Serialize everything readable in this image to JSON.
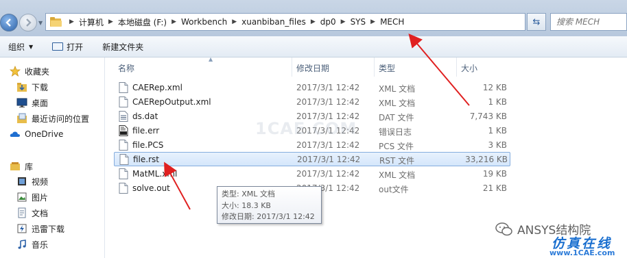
{
  "address_bar": {
    "breadcrumbs": [
      "计算机",
      "本地磁盘 (F:)",
      "Workbench",
      "xuanbiban_files",
      "dp0",
      "SYS",
      "MECH"
    ],
    "search_placeholder": "搜索 MECH"
  },
  "toolbar": {
    "organize_label": "组织",
    "open_label": "打开",
    "new_folder_label": "新建文件夹"
  },
  "sidebar": {
    "favorites_label": "收藏夹",
    "favorites": [
      {
        "label": "下载",
        "icon": "download-folder-icon"
      },
      {
        "label": "桌面",
        "icon": "desktop-icon"
      },
      {
        "label": "最近访问的位置",
        "icon": "recent-places-icon"
      }
    ],
    "onedrive_label": "OneDrive",
    "libraries_label": "库",
    "libraries": [
      {
        "label": "视频",
        "icon": "video-library-icon"
      },
      {
        "label": "图片",
        "icon": "pictures-library-icon"
      },
      {
        "label": "文档",
        "icon": "documents-library-icon"
      },
      {
        "label": "迅雷下载",
        "icon": "thunder-download-icon"
      },
      {
        "label": "音乐",
        "icon": "music-library-icon"
      }
    ]
  },
  "columns": {
    "name": "名称",
    "date": "修改日期",
    "type": "类型",
    "size": "大小"
  },
  "files": [
    {
      "name": "CAERep.xml",
      "date": "2017/3/1 12:42",
      "type": "XML 文档",
      "size": "12 KB",
      "icon": "xml-file-icon"
    },
    {
      "name": "CAERepOutput.xml",
      "date": "2017/3/1 12:42",
      "type": "XML 文档",
      "size": "1 KB",
      "icon": "xml-file-icon"
    },
    {
      "name": "ds.dat",
      "date": "2017/3/1 12:42",
      "type": "DAT 文件",
      "size": "7,743 KB",
      "icon": "dat-file-icon"
    },
    {
      "name": "file.err",
      "date": "2017/3/1 12:42",
      "type": "错误日志",
      "size": "1 KB",
      "icon": "error-log-icon"
    },
    {
      "name": "file.PCS",
      "date": "2017/3/1 12:42",
      "type": "PCS 文件",
      "size": "3 KB",
      "icon": "generic-file-icon"
    },
    {
      "name": "file.rst",
      "date": "2017/3/1 12:42",
      "type": "RST 文件",
      "size": "33,216 KB",
      "icon": "generic-file-icon",
      "selected": true
    },
    {
      "name": "MatML.xml",
      "date": "2017/3/1 12:42",
      "type": "XML 文档",
      "size": "19 KB",
      "icon": "xml-file-icon"
    },
    {
      "name": "solve.out",
      "date": "2017/3/1 12:42",
      "type": "out文件",
      "size": "21 KB",
      "icon": "generic-file-icon"
    }
  ],
  "tooltip": {
    "type_line": "类型: XML 文档",
    "size_line": "大小: 18.3 KB",
    "date_line": "修改日期: 2017/3/1 12:42"
  },
  "watermarks": {
    "center": "1CAE.COM",
    "brand": "ANSYS结构院",
    "cn": "仿真在线",
    "url": "www.1CAE.com"
  },
  "colors": {
    "accent": "#2d62a8",
    "selection_border": "#84acdd",
    "annotation_arrow": "#e02020"
  }
}
